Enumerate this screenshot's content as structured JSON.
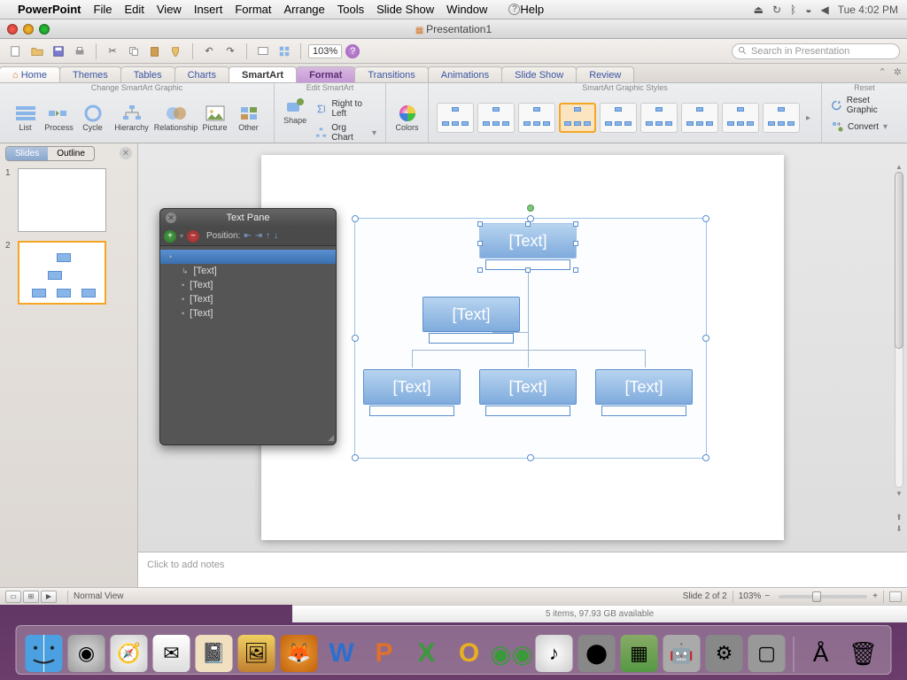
{
  "menubar": {
    "app": "PowerPoint",
    "items": [
      "File",
      "Edit",
      "View",
      "Insert",
      "Format",
      "Arrange",
      "Tools",
      "Slide Show",
      "Window",
      "Help"
    ],
    "clock": "Tue 4:02 PM"
  },
  "window": {
    "title": "Presentation1"
  },
  "quickbar": {
    "zoom": "103%",
    "search_placeholder": "Search in Presentation"
  },
  "tabs": [
    "Home",
    "Themes",
    "Tables",
    "Charts",
    "SmartArt",
    "Format",
    "Transitions",
    "Animations",
    "Slide Show",
    "Review"
  ],
  "ribbon": {
    "groups": {
      "change": {
        "label": "Change SmartArt Graphic",
        "buttons": [
          "List",
          "Process",
          "Cycle",
          "Hierarchy",
          "Relationship",
          "Picture",
          "Other"
        ]
      },
      "edit": {
        "label": "Edit SmartArt",
        "shape": "Shape",
        "rtl": "Right to Left",
        "org": "Org Chart"
      },
      "colors": "Colors",
      "styles_label": "SmartArt Graphic Styles",
      "reset": {
        "label": "Reset",
        "reset": "Reset Graphic",
        "convert": "Convert"
      }
    }
  },
  "slidepanel": {
    "tabs": [
      "Slides",
      "Outline"
    ],
    "slides": [
      1,
      2
    ]
  },
  "smartart": {
    "placeholder": "[Text]",
    "nodes": [
      "[Text]",
      "[Text]",
      "[Text]",
      "[Text]",
      "[Text]"
    ]
  },
  "textpane": {
    "title": "Text Pane",
    "position": "Position:",
    "items": [
      "",
      "[Text]",
      "[Text]",
      "[Text]",
      "[Text]"
    ]
  },
  "notes_placeholder": "Click to add notes",
  "statusbar": {
    "view": "Normal View",
    "slide": "Slide 2 of 2",
    "zoom": "103%"
  },
  "finder": "5 items, 97.93 GB available"
}
